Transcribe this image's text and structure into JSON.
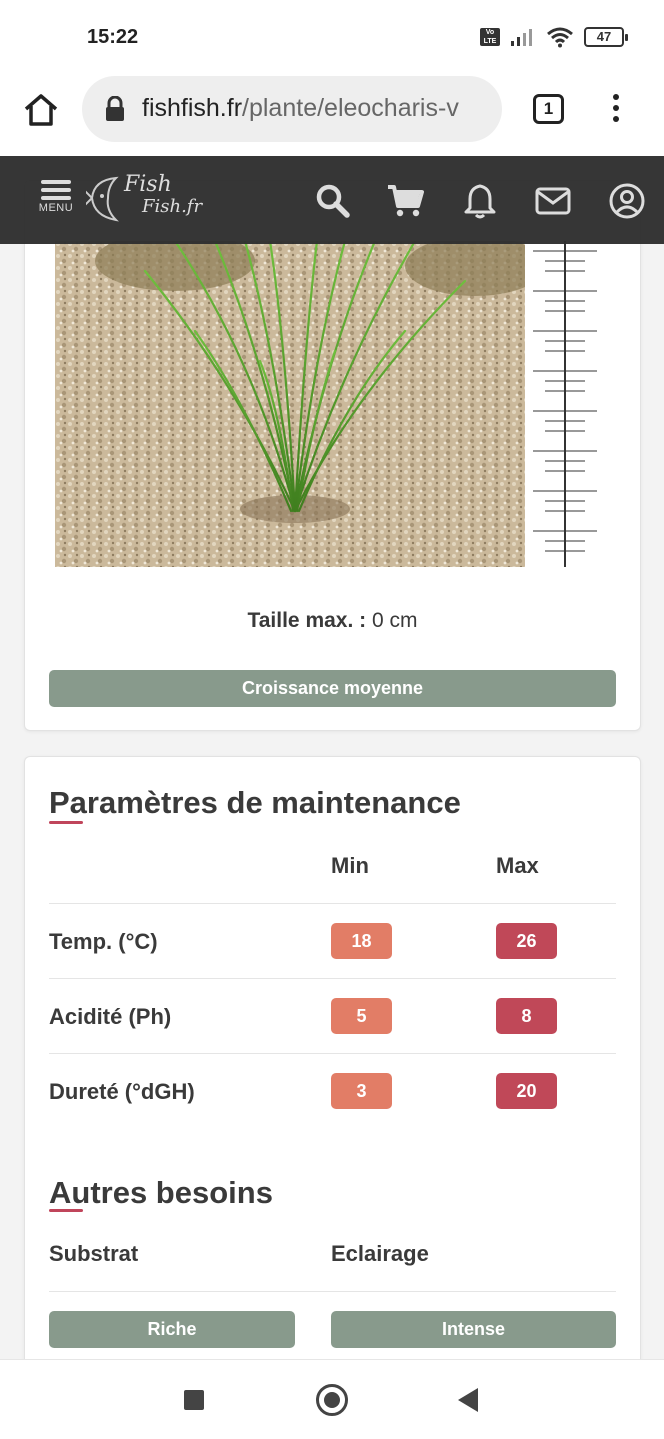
{
  "status_bar": {
    "time": "15:22",
    "volte_label": "Vo LTE",
    "battery": "47"
  },
  "browser": {
    "url_domain": "fishfish.fr",
    "url_path": "/plante/eleocharis-v",
    "tab_count": "1"
  },
  "site_header": {
    "menu_label": "MENU",
    "logo_line1": "Fish",
    "logo_line2": "Fish.fr"
  },
  "plant_card": {
    "size_label": "Taille max. :",
    "size_value": " 0 cm",
    "growth": "Croissance moyenne"
  },
  "maintenance": {
    "title": "Paramètres de maintenance",
    "col_min": "Min",
    "col_max": "Max",
    "rows": [
      {
        "label": "Temp. (°C)",
        "min": "18",
        "max": "26"
      },
      {
        "label": "Acidité (Ph)",
        "min": "5",
        "max": "8"
      },
      {
        "label": "Dureté (°dGH)",
        "min": "3",
        "max": "20"
      }
    ]
  },
  "other_needs": {
    "title": "Autres besoins",
    "col_substrate": "Substrat",
    "col_lighting": "Eclairage",
    "substrate_value": "Riche",
    "lighting_value": "Intense"
  },
  "colors": {
    "header_bg": "#303030",
    "pill_green": "#889a8c",
    "badge_min": "#e27d66",
    "badge_max": "#c04858",
    "title_accent": "#c0455b"
  }
}
